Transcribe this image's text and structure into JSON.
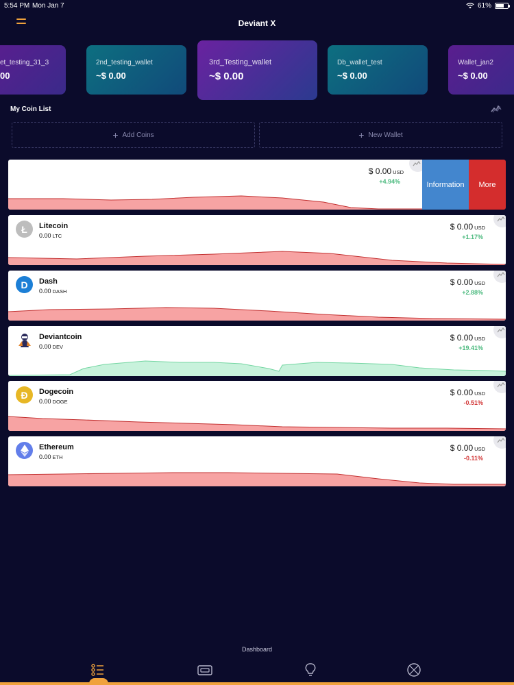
{
  "status_bar": {
    "time": "5:54 PM",
    "date": "Mon Jan 7",
    "battery": "61%"
  },
  "header": {
    "title": "Deviant X"
  },
  "wallets": [
    {
      "name": "et_testing_31_3",
      "balance": "00"
    },
    {
      "name": "2nd_testing_wallet",
      "balance": "~$ 0.00"
    },
    {
      "name": "3rd_Testing_wallet",
      "balance": "~$ 0.00"
    },
    {
      "name": "Db_wallet_test",
      "balance": "~$ 0.00"
    },
    {
      "name": "Wallet_jan2",
      "balance": "~$ 0.00"
    }
  ],
  "coin_list": {
    "title": "My Coin List",
    "add_coins": "Add Coins",
    "new_wallet": "New Wallet",
    "swipe_actions": {
      "information": "Information",
      "more": "More"
    },
    "swiped_row": {
      "price": "$ 0.00",
      "currency": "USD",
      "change": "+4.94%"
    },
    "coins": [
      {
        "name": "Litecoin",
        "amount": "0.00",
        "symbol": "LTC",
        "price": "$ 0.00",
        "currency": "USD",
        "change": "+1.17%",
        "trend": "positive"
      },
      {
        "name": "Dash",
        "amount": "0.00",
        "symbol": "DASH",
        "price": "$ 0.00",
        "currency": "USD",
        "change": "+2.88%",
        "trend": "positive"
      },
      {
        "name": "Deviantcoin",
        "amount": "0.00",
        "symbol": "DEV",
        "price": "$ 0.00",
        "currency": "USD",
        "change": "+19.41%",
        "trend": "positive"
      },
      {
        "name": "Dogecoin",
        "amount": "0.00",
        "symbol": "DOGE",
        "price": "$ 0.00",
        "currency": "USD",
        "change": "-0.51%",
        "trend": "negative"
      },
      {
        "name": "Ethereum",
        "amount": "0.00",
        "symbol": "ETH",
        "price": "$ 0.00",
        "currency": "USD",
        "change": "-0.11%",
        "trend": "negative"
      }
    ]
  },
  "bottom_nav": {
    "active_label": "Dashboard"
  },
  "colors": {
    "background": "#0b0b2b",
    "accent": "#f0a23c",
    "positive": "#4cba7f",
    "negative": "#d33a3a",
    "info": "#4386ce",
    "more": "#d42d2d"
  },
  "icons": [
    "menu-icon",
    "chart-toggle-icon",
    "plus-icon",
    "litecoin-icon",
    "dash-icon",
    "deviantcoin-icon",
    "dogecoin-icon",
    "ethereum-icon",
    "list-icon",
    "wallet-icon",
    "lightbulb-icon",
    "compass-icon"
  ]
}
